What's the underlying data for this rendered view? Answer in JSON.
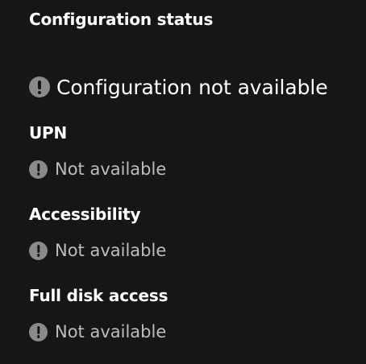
{
  "panel": {
    "title": "Configuration status",
    "overall_status": {
      "icon": "exclamation-circle-icon",
      "text": "Configuration not available"
    },
    "items": [
      {
        "label": "UPN",
        "status": "Not available",
        "icon": "exclamation-circle-icon"
      },
      {
        "label": "Accessibility",
        "status": "Not available",
        "icon": "exclamation-circle-icon"
      },
      {
        "label": "Full disk access",
        "status": "Not available",
        "icon": "exclamation-circle-icon"
      }
    ]
  },
  "colors": {
    "background": "#161616",
    "text_primary": "#ffffff",
    "text_secondary": "#bdbdbd",
    "icon": "#8a8a8a"
  }
}
